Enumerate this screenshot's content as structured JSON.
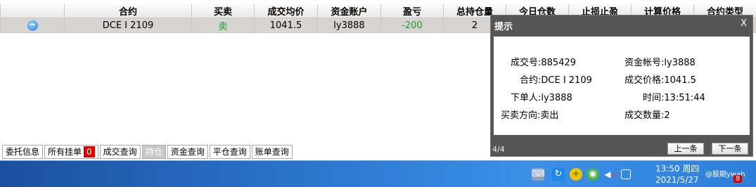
{
  "table": {
    "headers": [
      "",
      "合约",
      "买卖",
      "成交均价",
      "资金账户",
      "盈亏",
      "总持仓量",
      "今日仓数",
      "止损止盈",
      "计算价格",
      "合约类型"
    ],
    "row": {
      "toggle": "−",
      "contract": "DCE I 2109",
      "side": "卖",
      "avg_price": "1041.5",
      "account": "ly3888",
      "pnl": "-200",
      "total_position": "2"
    }
  },
  "tabs": [
    {
      "label": "委托信息"
    },
    {
      "label": "所有挂单",
      "badge": "0"
    },
    {
      "label": "成交查询"
    },
    {
      "label": "持仓",
      "active": true
    },
    {
      "label": "资金查询"
    },
    {
      "label": "平仓查询"
    },
    {
      "label": "账单查询"
    }
  ],
  "popup": {
    "title": "提示",
    "close": "X",
    "fields": {
      "trade_no": "成交号:885429",
      "account": "资金帐号:ly3888",
      "contract": "合约:DCE I 2109",
      "price": "成交价格:1041.5",
      "orderer": "下单人:ly3888",
      "time": "时间:13:51:44",
      "direction": "买卖方向:卖出",
      "quantity": "成交数量:2"
    },
    "counter": "4/4",
    "prev": "上一条",
    "next": "下一条"
  },
  "taskbar": {
    "time": "13:50 周四",
    "date": "2021/5/27",
    "user": "@股期ywah",
    "notif_count": "8",
    "volume_mute": "×"
  },
  "colors": {
    "pnl_negative": "#1e9a2a",
    "popup_bg": "#555555",
    "taskbar": "#2d79d2",
    "badge": "#e00000"
  }
}
